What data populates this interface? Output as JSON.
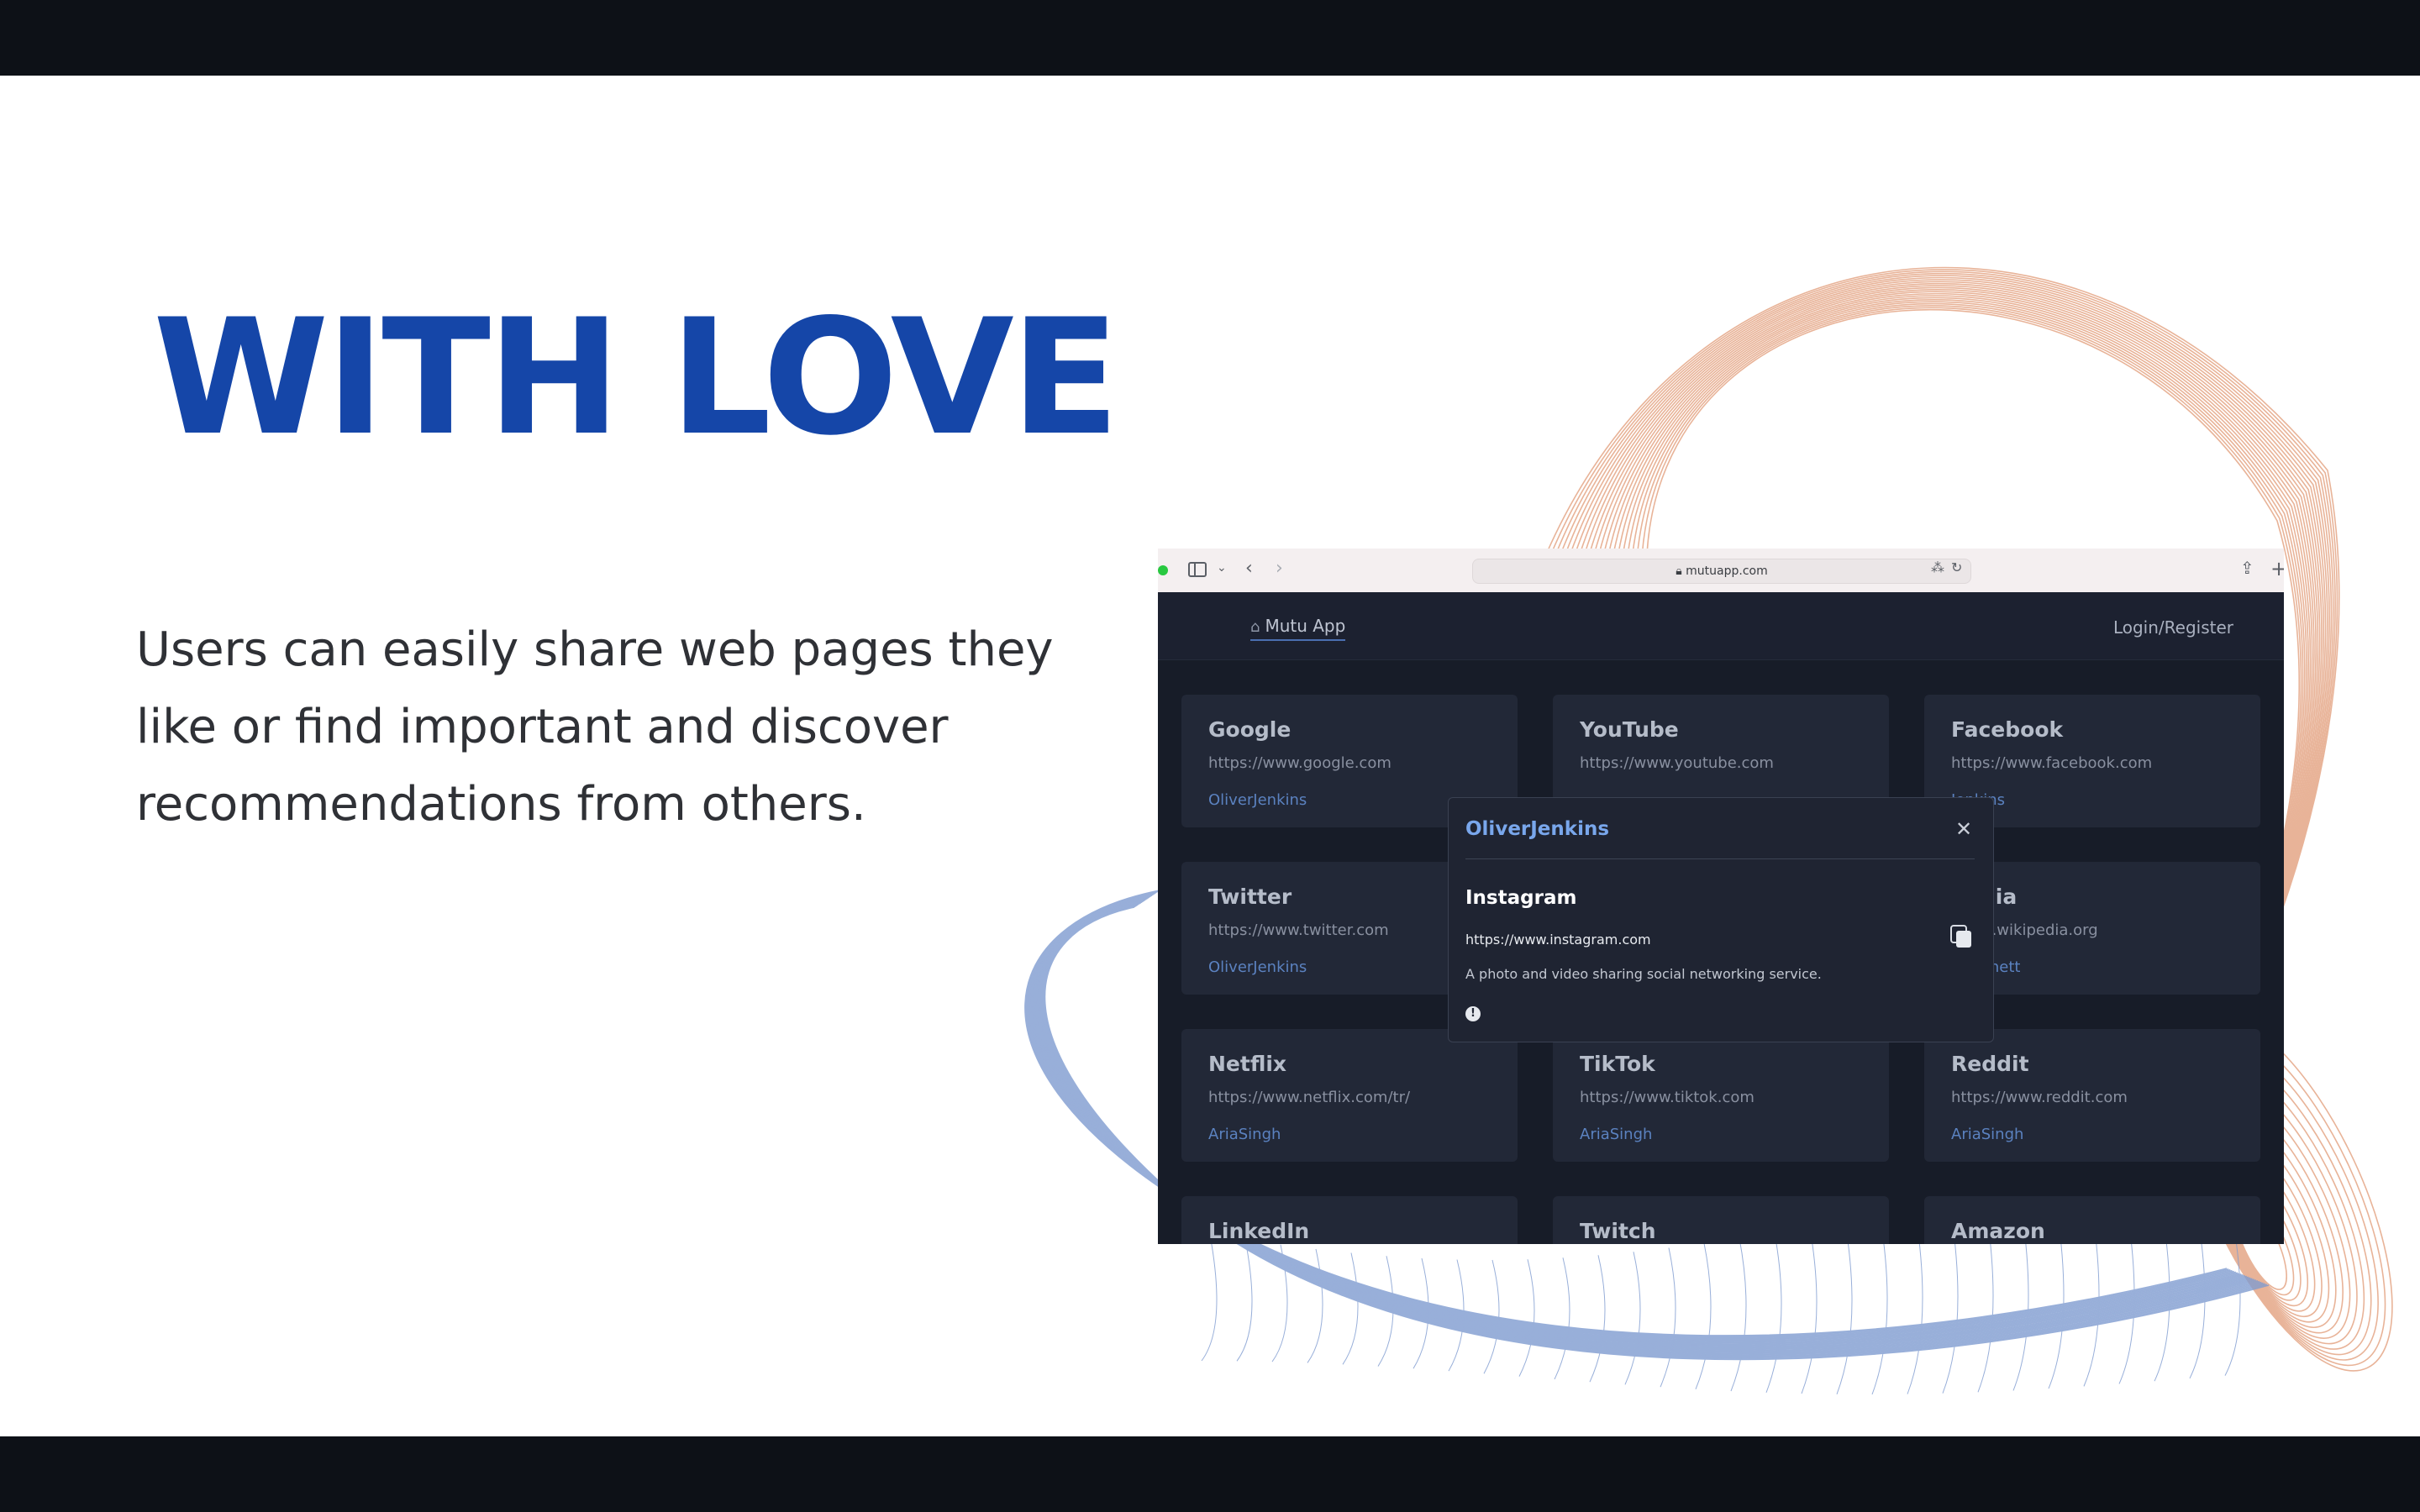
{
  "slide": {
    "headline": "WITH LOVE",
    "description": "Users can easily share web pages they like or find important and discover recommendations from others."
  },
  "browser": {
    "address": "mutuapp.com",
    "accent": "#28c840"
  },
  "app": {
    "brand": "Mutu App",
    "login": "Login/Register"
  },
  "cards": [
    {
      "title": "Google",
      "url": "https://www.google.com",
      "user": "OliverJenkins"
    },
    {
      "title": "YouTube",
      "url": "https://www.youtube.com",
      "user": ""
    },
    {
      "title": "Facebook",
      "url": "https://www.facebook.com",
      "user": "Jenkins"
    },
    {
      "title": "Twitter",
      "url": "https://www.twitter.com",
      "user": "OliverJenkins"
    },
    {
      "title": "",
      "url": "",
      "user": ""
    },
    {
      "title": "pedia",
      "url": "/www.wikipedia.org",
      "user": "aBennett"
    },
    {
      "title": "Netflix",
      "url": "https://www.netflix.com/tr/",
      "user": "AriaSingh"
    },
    {
      "title": "TikTok",
      "url": "https://www.tiktok.com",
      "user": "AriaSingh"
    },
    {
      "title": "Reddit",
      "url": "https://www.reddit.com",
      "user": "AriaSingh"
    },
    {
      "title": "LinkedIn",
      "url": "",
      "user": ""
    },
    {
      "title": "Twitch",
      "url": "",
      "user": ""
    },
    {
      "title": "Amazon",
      "url": "",
      "user": ""
    }
  ],
  "modal": {
    "user": "OliverJenkins",
    "title": "Instagram",
    "url": "https://www.instagram.com",
    "description": "A photo and video sharing social networking service."
  },
  "colors": {
    "headline": "#1546a8",
    "wave_blue": "#7f9bd0",
    "wave_orange": "#e3a17f"
  }
}
